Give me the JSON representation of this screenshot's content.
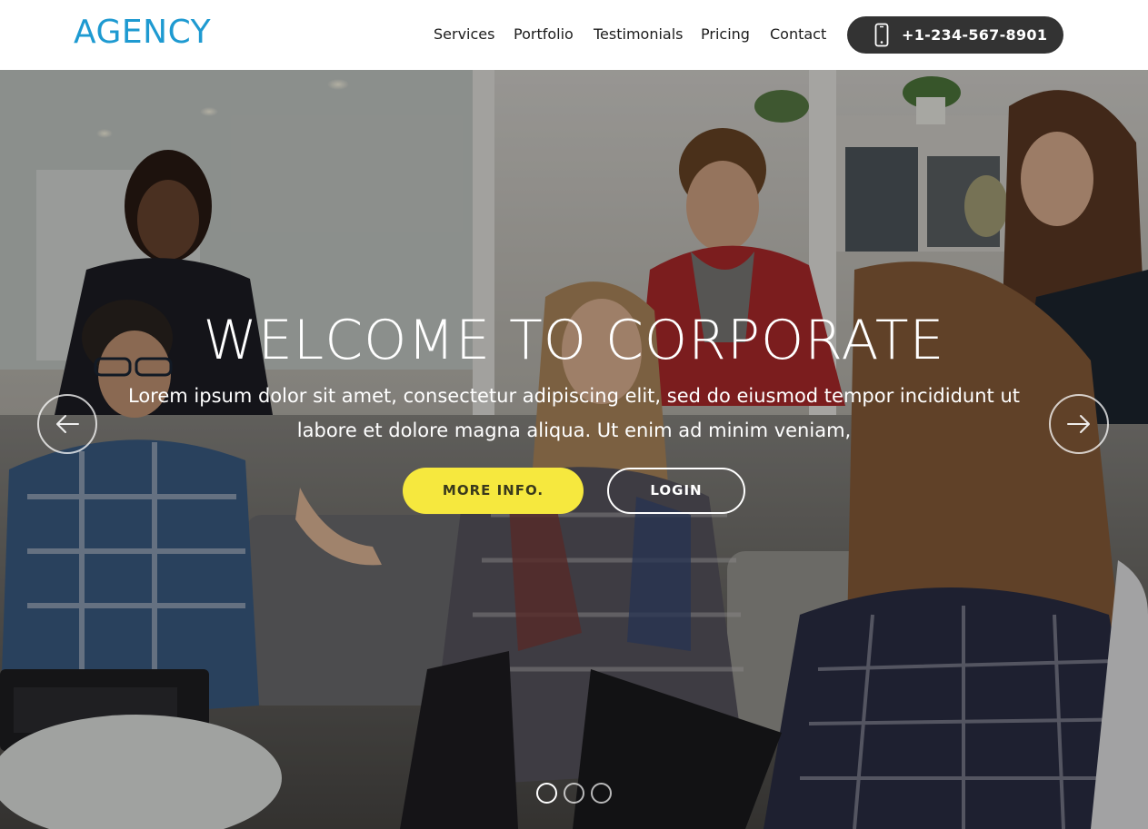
{
  "header": {
    "logo": "AGENCY",
    "nav": [
      {
        "label": "Services"
      },
      {
        "label": "Portfolio"
      },
      {
        "label": "Testimonials"
      },
      {
        "label": "Pricing"
      },
      {
        "label": "Contact"
      }
    ],
    "phone": {
      "icon": "smartphone-icon",
      "number": "+1-234-567-8901"
    }
  },
  "hero": {
    "title": "WELCOME TO CORPORATE",
    "subtitle_line1": "Lorem ipsum dolor sit amet, consectetur adipiscing elit, sed do eiusmod tempor incididunt ut",
    "subtitle_line2": "labore et dolore magna aliqua. Ut enim ad minim veniam,",
    "primary_button": "MORE INFO.",
    "secondary_button": "LOGIN",
    "prev_icon": "arrow-left-icon",
    "next_icon": "arrow-right-icon",
    "slides": 3,
    "active_slide": 1
  },
  "colors": {
    "brand": "#1e9ad1",
    "phone_button": "#333333",
    "primary_button": "#f6e83e"
  }
}
